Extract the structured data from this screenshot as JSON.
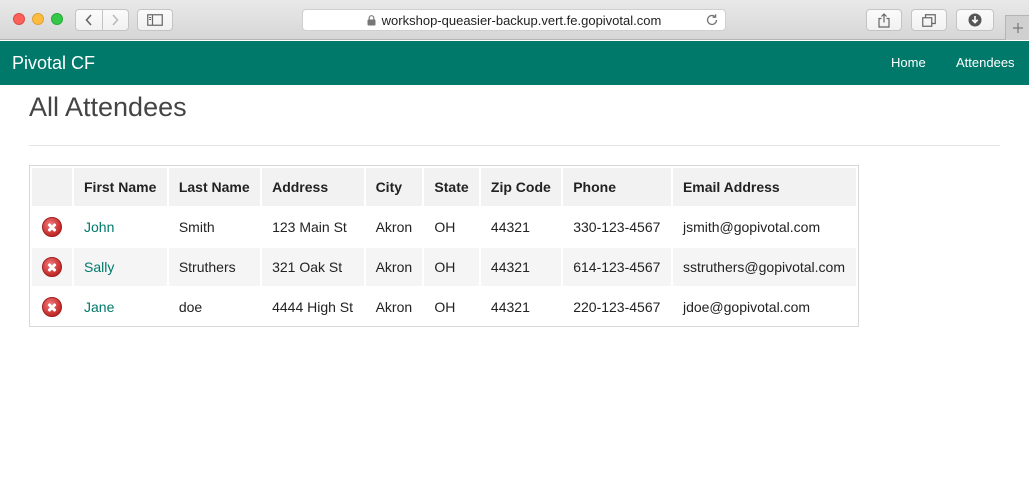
{
  "browser": {
    "url": "workshop-queasier-backup.vert.fe.gopivotal.com"
  },
  "navbar": {
    "brand": "Pivotal CF",
    "links": [
      {
        "label": "Home"
      },
      {
        "label": "Attendees"
      }
    ],
    "color": "#00796b"
  },
  "page": {
    "title": "All Attendees"
  },
  "table": {
    "headers": [
      "",
      "First Name",
      "Last Name",
      "Address",
      "City",
      "State",
      "Zip Code",
      "Phone",
      "Email Address"
    ],
    "rows": [
      {
        "first_name": "John",
        "last_name": "Smith",
        "address": "123 Main St",
        "city": "Akron",
        "state": "OH",
        "zip": "44321",
        "phone": "330-123-4567",
        "email": "jsmith@gopivotal.com"
      },
      {
        "first_name": "Sally",
        "last_name": "Struthers",
        "address": "321 Oak St",
        "city": "Akron",
        "state": "OH",
        "zip": "44321",
        "phone": "614-123-4567",
        "email": "sstruthers@gopivotal.com"
      },
      {
        "first_name": "Jane",
        "last_name": "doe",
        "address": "4444 High St",
        "city": "Akron",
        "state": "OH",
        "zip": "44321",
        "phone": "220-123-4567",
        "email": "jdoe@gopivotal.com"
      }
    ],
    "row_action_icon": "delete-icon"
  }
}
